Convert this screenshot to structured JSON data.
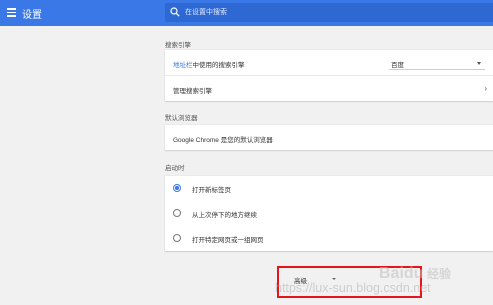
{
  "header": {
    "title": "设置",
    "search_placeholder": "在设置中搜索"
  },
  "search_engine": {
    "section_label": "搜索引擎",
    "address_bar_link": "地址栏",
    "address_bar_rest": "中使用的搜索引擎",
    "selected_engine": "百度",
    "manage_label": "管理搜索引擎"
  },
  "default_browser": {
    "section_label": "默认浏览器",
    "status_text": "Google Chrome 是您的默认浏览器"
  },
  "startup": {
    "section_label": "启动时",
    "options": [
      {
        "label": "打开新标签页",
        "selected": true
      },
      {
        "label": "从上次停下的地方继续",
        "selected": false
      },
      {
        "label": "打开特定网页或一组网页",
        "selected": false
      }
    ]
  },
  "advanced_label": "高级",
  "watermark": {
    "brand": "Baidu 经验",
    "url": "https://lux-sun.blog.csdn.net"
  },
  "colors": {
    "header_bg": "#3b78e7",
    "accent": "#3b78e7",
    "highlight_border": "#e4161b"
  }
}
